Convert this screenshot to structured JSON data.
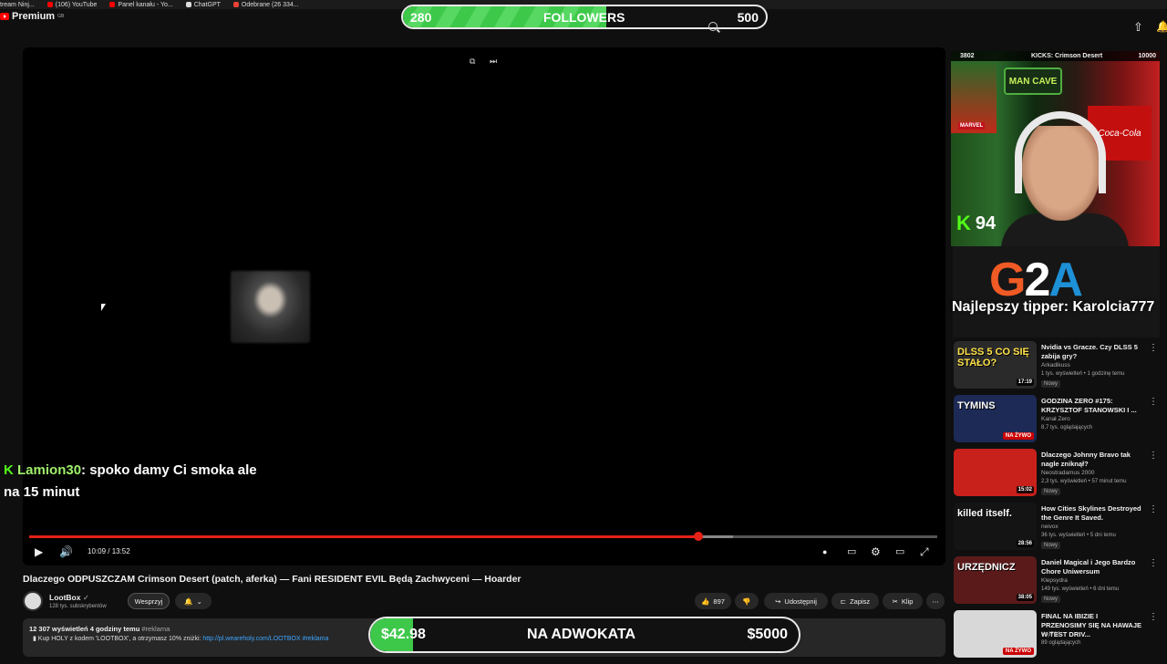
{
  "bookmarks": [
    {
      "label": "tream Ninj...",
      "color": "#5a5a5a"
    },
    {
      "label": "(106) YouTube",
      "color": "#ff0000"
    },
    {
      "label": "Panel kanału - Yo...",
      "color": "#ff0000"
    },
    {
      "label": "ChatGPT",
      "color": "#dddddd"
    },
    {
      "label": "Odebrane (26 334...",
      "color": "#ea4335"
    }
  ],
  "header": {
    "logo": "Premium",
    "logo_sup": "GB"
  },
  "followers_goal": {
    "current": "280",
    "label": "FOLLOWERS",
    "target": "500",
    "progress": 0.56
  },
  "player": {
    "time": "10:09 / 13:52",
    "progress_played": 0.737,
    "progress_buffered": 0.775
  },
  "chat_overlay": {
    "user": "Lamion30",
    "message_line1": ": spoko damy Ci smoka ale",
    "message_line2": "na 15 minut"
  },
  "video": {
    "title": "Dlaczego ODPUSZCZAM Crimson Desert (patch, aferka) — Fani RESIDENT EVIL Będą Zachwyceni — Hoarder",
    "channel": "LootBox",
    "subs": "128 tys. subskrybentów",
    "join_label": "Wesprzyj",
    "likes": "897",
    "share_label": "Udostępnij",
    "save_label": "Zapisz",
    "clip_label": "Klip",
    "desc_views": "12 307 wyświetleń  4 godziny temu",
    "desc_tag": "#reklama",
    "desc_line": "Kup HOLY z kodem 'LOOTBOX', a otrzymasz 10% zniżki: ",
    "desc_link": "http://pl.weareholy.com/LOOTBOX #reklama"
  },
  "donation_goal": {
    "current": "$42.98",
    "label": "NA ADWOKATA",
    "target": "$5000",
    "progress": 0.0086
  },
  "webcam": {
    "kicks_left": "3802",
    "kicks_mid": "KICKS: Crimson Desert",
    "kicks_right": "10000",
    "sign": "MAN CAVE",
    "cola": "Coca-Cola",
    "marvel": "MARVEL",
    "kick_count": "94"
  },
  "sponsor": {
    "logo": [
      "G",
      "2",
      "A"
    ],
    "tipper": "Najlepszy tipper: Karolcia777"
  },
  "recommendations": [
    {
      "title": "Nvidia vs Gracze. Czy DLSS 5 zabija gry?",
      "channel": "Arkadikuss",
      "meta": "1 tys. wyświetleń • 1 godzinę temu",
      "badge": "Nowy",
      "duration": "17:19",
      "thumb_text": "DLSS 5 CO SIĘ STAŁO?",
      "thumb_bg": "#2a2a2a",
      "thumb_color": "#ffe24a"
    },
    {
      "title": "GODZINA ZERO #175: KRZYSZTOF STANOWSKI I ...",
      "channel": "Kanał Zero",
      "meta": "8,7 tys. oglądających",
      "badge": "",
      "duration": "NA ŻYWO",
      "thumb_text": "TYMINS",
      "thumb_bg": "#1c2a55",
      "thumb_color": "#ffffff"
    },
    {
      "title": "Dlaczego Johnny Bravo tak nagle zniknął?",
      "channel": "Neostradamus 2000",
      "meta": "2,3 tys. wyświetleń • 57 minut temu",
      "badge": "Nowy",
      "duration": "15:02",
      "thumb_text": "",
      "thumb_bg": "#c8201a",
      "thumb_color": "#ffffff"
    },
    {
      "title": "How Cities Skylines Destroyed the Genre It Saved.",
      "channel": "neivox",
      "meta": "36 tys. wyświetleń • 5 dni temu",
      "badge": "Nowy",
      "duration": "28:56",
      "thumb_text": "killed itself.",
      "thumb_bg": "#141414",
      "thumb_color": "#ffffff"
    },
    {
      "title": "Daniel Magical i Jego Bardzo Chore Uniwersum",
      "channel": "Klepsydra",
      "meta": "149 tys. wyświetleń • 6 dni temu",
      "badge": "Nowy",
      "duration": "38:05",
      "thumb_text": "URZĘDNICZ",
      "thumb_bg": "#5a1a1a",
      "thumb_color": "#ffffff"
    },
    {
      "title": "FINAL NA IBIZIE I PRZENOSIMY SIĘ NA HAWAJE W TEST DRIV...",
      "channel": "Yoji720",
      "meta": "89 oglądających",
      "badge": "",
      "duration": "NA ŻYWO",
      "thumb_text": "",
      "thumb_bg": "#d8d8d8",
      "thumb_color": "#c00"
    }
  ]
}
